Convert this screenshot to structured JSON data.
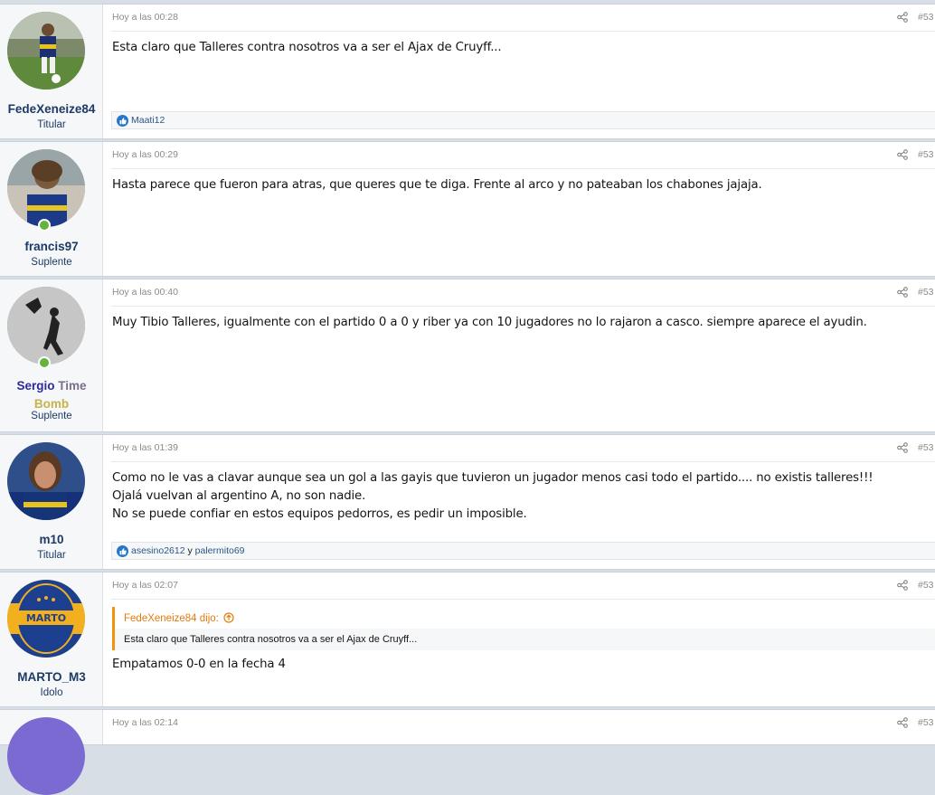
{
  "posts": [
    {
      "username": "FedeXeneize84",
      "usertitle": "Titular",
      "time": "Hoy a las 00:28",
      "number": "#53",
      "lines": [
        "Esta claro que Talleres contra nosotros va a ser el Ajax de Cruyff..."
      ],
      "reactions": "Maati12"
    },
    {
      "username": "francis97",
      "usertitle": "Suplente",
      "time": "Hoy a las 00:29",
      "number": "#53",
      "lines": [
        "Hasta parece que fueron para atras, que queres que te diga. Frente al arco y no pateaban los chabones jajaja."
      ]
    },
    {
      "username_part1": "Sergio",
      "username_part2": "Time",
      "username_part3": "Bomb",
      "usertitle": "Suplente",
      "time": "Hoy a las 00:40",
      "number": "#53",
      "lines": [
        "Muy Tibio Talleres, igualmente con el partido 0 a 0 y riber ya con 10 jugadores no lo rajaron a casco. siempre aparece el ayudin."
      ]
    },
    {
      "username": "m10",
      "usertitle": "Titular",
      "time": "Hoy a las 01:39",
      "number": "#53",
      "lines": [
        "Como no le vas a clavar aunque sea un gol a las gayis que tuvieron un jugador menos casi todo el partido.... no existis talleres!!!",
        "Ojalá vuelvan al argentino A, no son nadie.",
        "No se puede confiar en estos equipos pedorros, es pedir un imposible."
      ],
      "reactions_a": "asesino2612",
      "reactions_conj": "y",
      "reactions_b": "palermito69"
    },
    {
      "username": "MARTO_M3",
      "usertitle": "Idolo",
      "time": "Hoy a las 02:07",
      "number": "#53",
      "quote_author": "FedeXeneize84 dijo:",
      "quote_text": "Esta claro que Talleres contra nosotros va a ser el Ajax de Cruyff...",
      "lines": [
        "Empatamos 0-0 en la fecha 4"
      ],
      "avatar_text": "MARTO"
    },
    {
      "time": "Hoy a las 02:14",
      "number": "#53"
    }
  ],
  "colors": {
    "username": "#1d3a66",
    "quote_accent": "#f2930d",
    "like": "#2577c8",
    "online": "#63b43e",
    "name_purple": "#2d2a9e",
    "name_gray": "#7d6e8a",
    "name_gold": "#c8b34a"
  },
  "icons": [
    "share-icon",
    "like-icon",
    "online-icon",
    "quote-arrow-icon"
  ]
}
